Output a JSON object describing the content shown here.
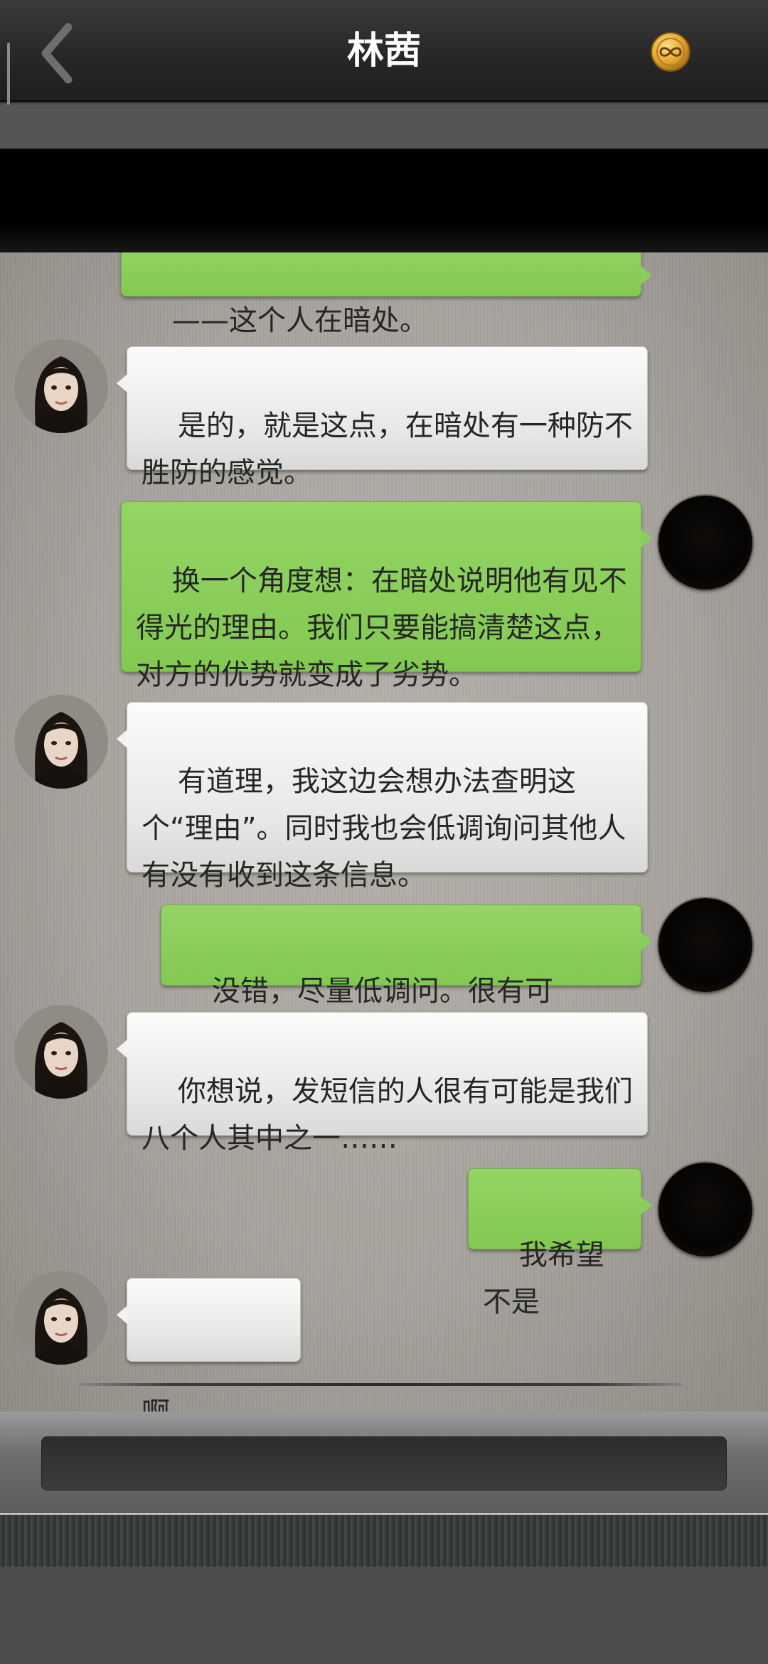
{
  "header": {
    "title": "林茜",
    "back_icon": "chevron-left-icon",
    "right_icon": "infinity-coin-icon"
  },
  "messages": [
    {
      "side": "out",
      "text": "——这个人在暗处。",
      "partial": true
    },
    {
      "side": "in",
      "text": "是的，就是这点，在暗处有一种防不胜防的感觉。"
    },
    {
      "side": "out",
      "text": "换一个角度想：在暗处说明他有见不得光的理由。我们只要能搞清楚这点，对方的优势就变成了劣势。"
    },
    {
      "side": "in",
      "text": "有道理，我这边会想办法查明这个“理由”。同时我也会低调询问其他人有没有收到这条信息。"
    },
    {
      "side": "out",
      "text": "没错，尽量低调问。很有可能……"
    },
    {
      "side": "in",
      "text": "你想说，发短信的人很有可能是我们八个人其中之一……"
    },
    {
      "side": "out",
      "text": "我希望不是"
    },
    {
      "side": "in",
      "text": "啊…………"
    }
  ],
  "input": {
    "value": ""
  },
  "colors": {
    "incoming_bubble": "#ececeb",
    "outgoing_bubble": "#8ace5b",
    "header_bg": "#262626",
    "chat_bg": "#a7a39d"
  }
}
